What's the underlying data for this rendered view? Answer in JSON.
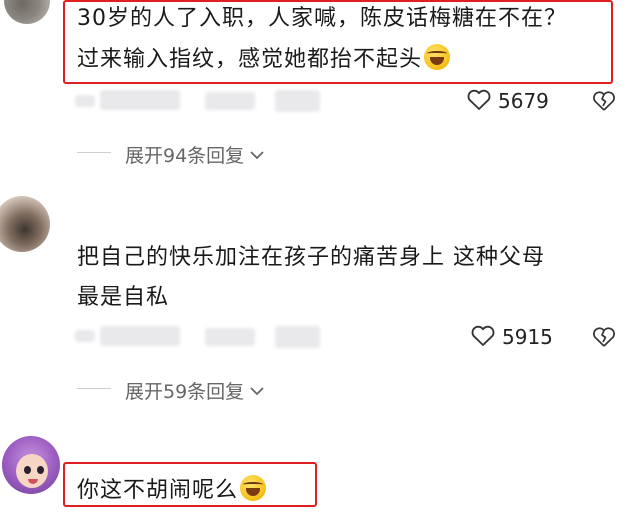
{
  "comments": [
    {
      "text_line1": "30岁的人了入职，人家喊，陈皮话梅糖在不在？",
      "text_line2": "过来输入指纹，感觉她都抬不起头",
      "likes": "5679",
      "replies": "展开94条回复",
      "highlighted": true
    },
    {
      "text_line1": "把自己的快乐加注在孩子的痛苦身上  这种父母",
      "text_line2": "最是自私",
      "likes": "5915",
      "replies": "展开59条回复",
      "highlighted": false
    },
    {
      "text_line1": "你这不胡闹呢么",
      "highlighted": true
    }
  ],
  "icons": {
    "like": "heart-outline-icon",
    "dislike": "broken-heart-icon",
    "expand": "chevron-down-icon",
    "emoji": "rolling-laughing-emoji"
  },
  "colors": {
    "highlight": "#e02020",
    "text": "#1a1a1a",
    "muted": "#666666"
  }
}
